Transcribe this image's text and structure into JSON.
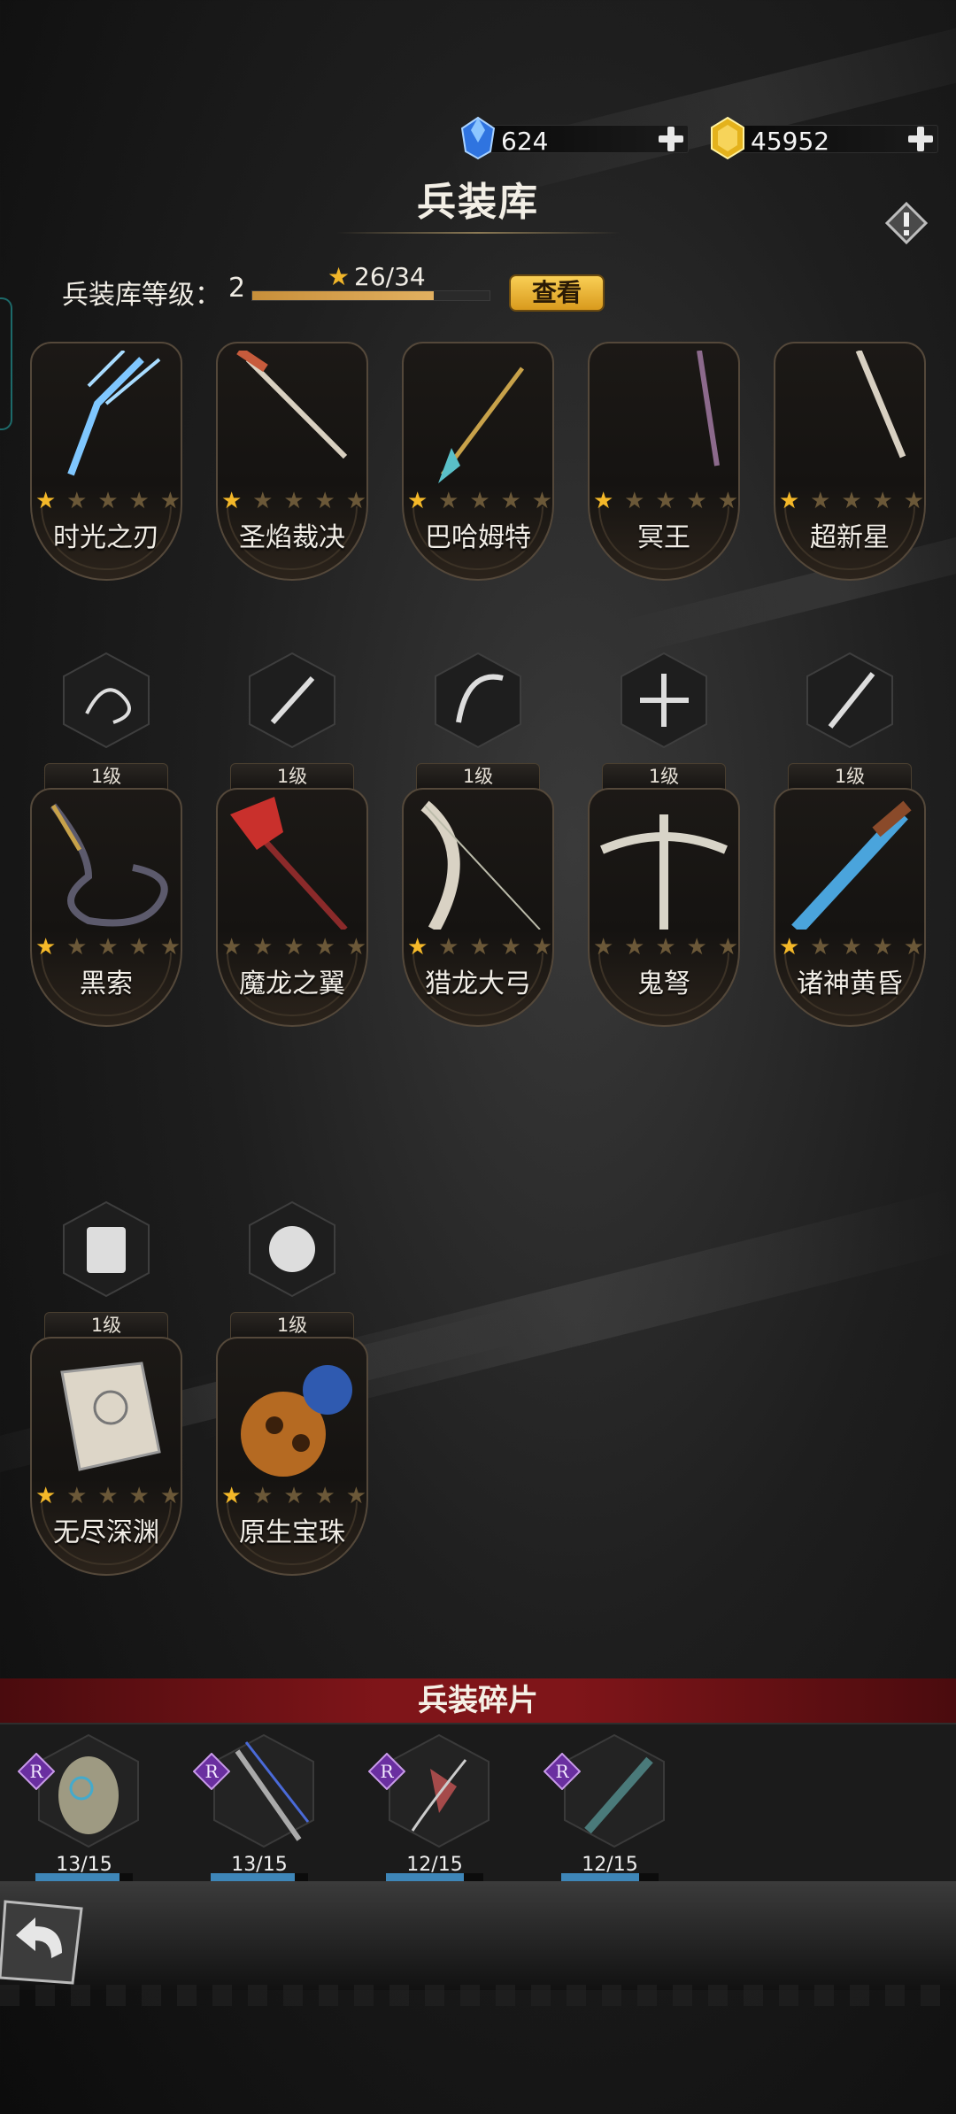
{
  "currency": {
    "diamonds": "624",
    "gold": "45952"
  },
  "header": {
    "title": "兵装库"
  },
  "armory_level": {
    "label": "兵装库等级：",
    "value": "2",
    "progress_text": "26/34",
    "progress_fraction": 0.765,
    "view_button": "查看"
  },
  "weapons_row1": [
    {
      "name": "时光之刃",
      "stars": 1
    },
    {
      "name": "圣焰裁决",
      "stars": 1
    },
    {
      "name": "巴哈姆特",
      "stars": 1
    },
    {
      "name": "冥王",
      "stars": 1
    },
    {
      "name": "超新星",
      "stars": 1
    }
  ],
  "weapons_row2": [
    {
      "name": "黑索",
      "level": "1级",
      "stars": 1
    },
    {
      "name": "魔龙之翼",
      "level": "1级",
      "stars": 0
    },
    {
      "name": "猎龙大弓",
      "level": "1级",
      "stars": 1
    },
    {
      "name": "鬼弩",
      "level": "1级",
      "stars": 0
    },
    {
      "name": "诸神黄昏",
      "level": "1级",
      "stars": 1
    }
  ],
  "weapons_row3": [
    {
      "name": "无尽深渊",
      "level": "1级",
      "stars": 1
    },
    {
      "name": "原生宝珠",
      "level": "1级",
      "stars": 1
    }
  ],
  "shards": {
    "title": "兵装碎片",
    "items": [
      {
        "rarity": "R",
        "count": "13/15",
        "fraction": 0.867
      },
      {
        "rarity": "R",
        "count": "13/15",
        "fraction": 0.867
      },
      {
        "rarity": "R",
        "count": "12/15",
        "fraction": 0.8
      },
      {
        "rarity": "R",
        "count": "12/15",
        "fraction": 0.8
      }
    ]
  },
  "icons": {
    "diamond": "blue-diamond-icon",
    "gold": "gold-gem-icon",
    "add": "plus-icon",
    "info": "warning-diamond-icon",
    "back": "back-arrow-icon"
  },
  "colors": {
    "accent_gold": "#f4b829",
    "banner_red": "#7f1519",
    "progress_blue": "#3e86b8"
  }
}
